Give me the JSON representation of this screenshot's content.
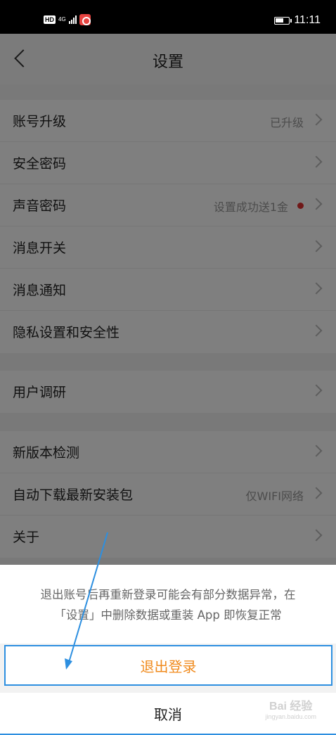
{
  "status_bar": {
    "hd": "HD",
    "network": "4G",
    "time": "11:11"
  },
  "header": {
    "title": "设置"
  },
  "groups": [
    {
      "items": [
        {
          "label": "账号升级",
          "value": "已升级"
        },
        {
          "label": "安全密码",
          "value": ""
        },
        {
          "label": "声音密码",
          "value": "设置成功送1金"
        },
        {
          "label": "消息开关",
          "value": ""
        },
        {
          "label": "消息通知",
          "value": ""
        },
        {
          "label": "隐私设置和安全性",
          "value": ""
        }
      ]
    },
    {
      "items": [
        {
          "label": "用户调研",
          "value": ""
        }
      ]
    },
    {
      "items": [
        {
          "label": "新版本检测",
          "value": ""
        },
        {
          "label": "自动下载最新安装包",
          "value": "仅WIFI网络"
        },
        {
          "label": "关于",
          "value": ""
        }
      ]
    }
  ],
  "dialog": {
    "message_line1": "退出账号后再重新登录可能会有部分数据异常，在",
    "message_line2": "「设置」中删除数据或重装 App 即恢复正常",
    "logout_label": "退出登录",
    "cancel_label": "取消"
  },
  "colors": {
    "accent_orange": "#f08a1c",
    "annotation_blue": "#2d8fe0",
    "badge_red": "#e03030"
  },
  "watermark": {
    "main": "Bai 经验",
    "sub": "jingyan.baidu.com"
  }
}
